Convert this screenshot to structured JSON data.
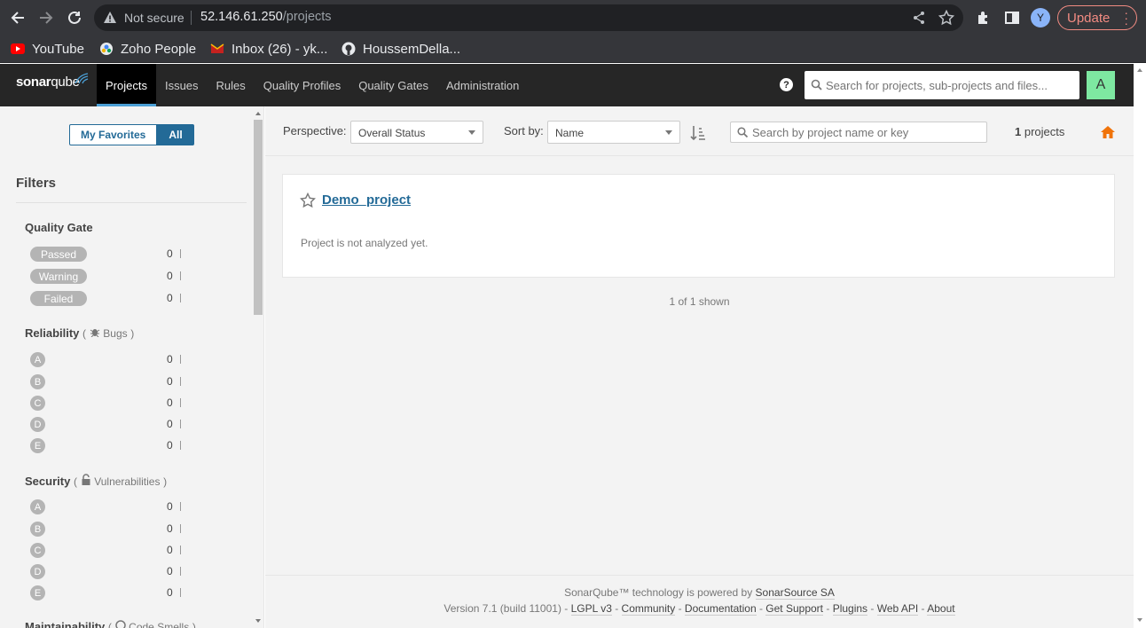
{
  "browser": {
    "security_label": "Not secure",
    "url_host": "52.146.61.250",
    "url_path": "/projects",
    "profile_initial": "Y",
    "update_label": "Update",
    "bookmarks": [
      {
        "label": "YouTube",
        "icon": "youtube-icon"
      },
      {
        "label": "Zoho People",
        "icon": "zoho-icon"
      },
      {
        "label": "Inbox (26) - yk...",
        "icon": "gmail-icon"
      },
      {
        "label": "HoussemDella...",
        "icon": "github-icon"
      }
    ]
  },
  "nav": {
    "logo_bold": "sonar",
    "logo_rest": "qube",
    "items": [
      {
        "label": "Projects",
        "active": true
      },
      {
        "label": "Issues"
      },
      {
        "label": "Rules"
      },
      {
        "label": "Quality Profiles"
      },
      {
        "label": "Quality Gates"
      },
      {
        "label": "Administration"
      }
    ],
    "search_placeholder": "Search for projects, sub-projects and files...",
    "user_initial": "A",
    "accent": "#4b9fd5",
    "avatar_color": "#7ee8a1"
  },
  "sidebar": {
    "toggle": {
      "favorites": "My Favorites",
      "all": "All"
    },
    "filters_title": "Filters",
    "quality_gate": {
      "title": "Quality Gate",
      "rows": [
        {
          "label": "Passed",
          "count": "0"
        },
        {
          "label": "Warning",
          "count": "0"
        },
        {
          "label": "Failed",
          "count": "0"
        }
      ]
    },
    "reliability": {
      "title": "Reliability",
      "open": "(",
      "sub": "Bugs",
      "close": ")",
      "icon": "bug-icon",
      "rows": [
        {
          "label": "A",
          "count": "0"
        },
        {
          "label": "B",
          "count": "0"
        },
        {
          "label": "C",
          "count": "0"
        },
        {
          "label": "D",
          "count": "0"
        },
        {
          "label": "E",
          "count": "0"
        }
      ]
    },
    "security": {
      "title": "Security",
      "open": "(",
      "sub": "Vulnerabilities",
      "close": ")",
      "icon": "lock-icon",
      "rows": [
        {
          "label": "A",
          "count": "0"
        },
        {
          "label": "B",
          "count": "0"
        },
        {
          "label": "C",
          "count": "0"
        },
        {
          "label": "D",
          "count": "0"
        },
        {
          "label": "E",
          "count": "0"
        }
      ]
    },
    "maintainability": {
      "title": "Maintainability",
      "open": "(",
      "sub": "Code Smells",
      "close": ")"
    }
  },
  "main": {
    "perspective_label": "Perspective:",
    "perspective_value": "Overall Status",
    "sort_label": "Sort by:",
    "sort_value": "Name",
    "search_placeholder": "Search by project name or key",
    "count_num": "1",
    "count_word": "projects",
    "project": {
      "name": "Demo_project",
      "note": "Project is not analyzed yet."
    },
    "shown": "1 of 1 shown",
    "home_color": "#f0730a"
  },
  "footer": {
    "powered": "SonarQube™ technology is powered by",
    "company": "SonarSource SA",
    "version": "Version 7.1 (build 11001)",
    "links": [
      "LGPL v3",
      "Community",
      "Documentation",
      "Get Support",
      "Plugins",
      "Web API",
      "About"
    ],
    "separator": " - "
  }
}
